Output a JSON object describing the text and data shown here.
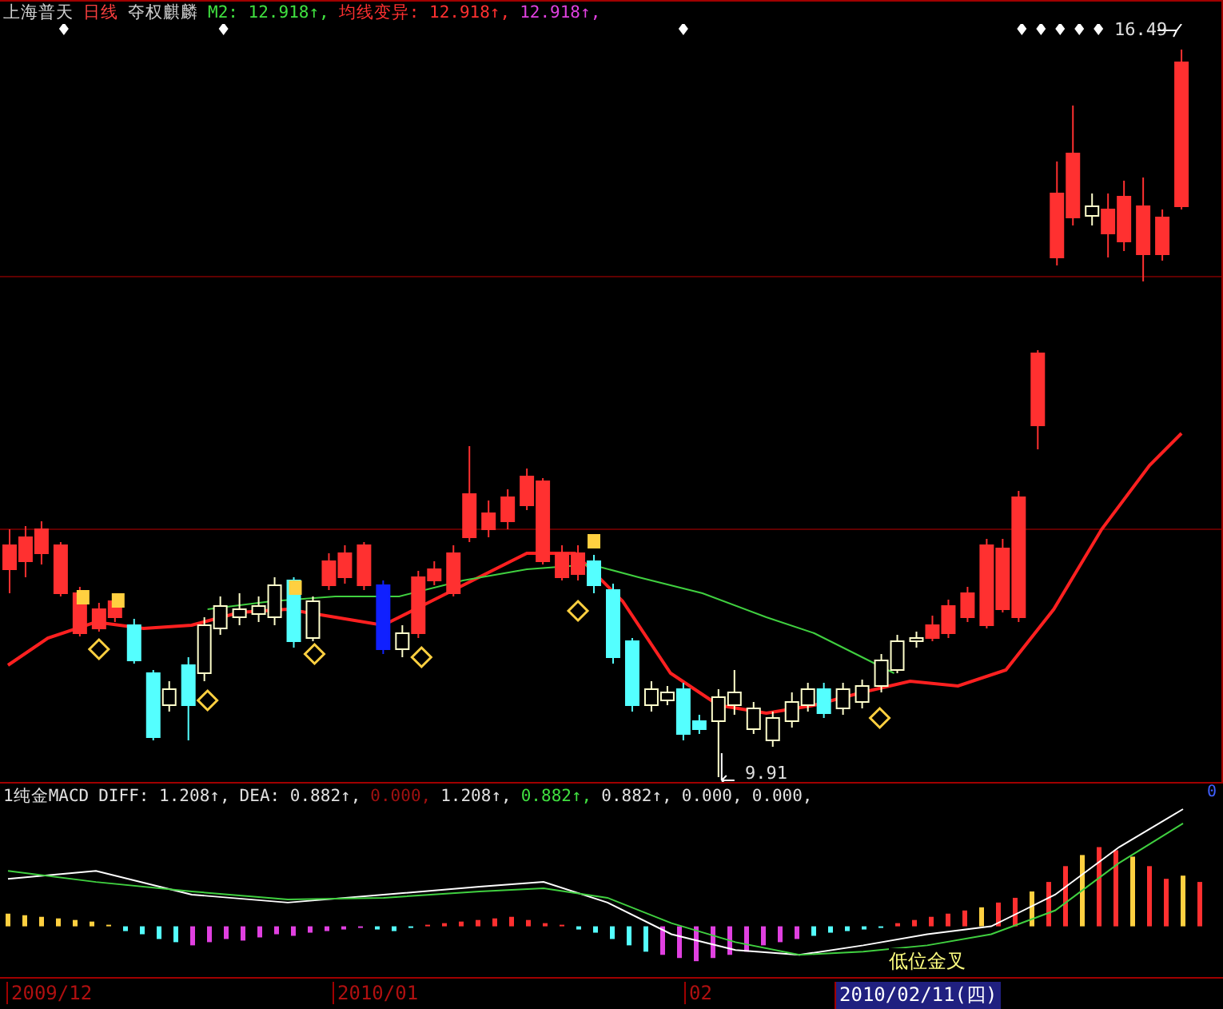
{
  "header": {
    "segments": [
      {
        "text": "上海普天",
        "color": "#d0d0d0"
      },
      {
        "text": "日线",
        "color": "#ff4040"
      },
      {
        "text": "夺权麒麟",
        "color": "#d0d0d0"
      },
      {
        "text": "M2: 12.918↑,",
        "color": "#40e040"
      },
      {
        "text": "均线变异: 12.918↑,",
        "color": "#ff3030"
      },
      {
        "text": "12.918↑,",
        "color": "#e040e0"
      }
    ]
  },
  "price_labels": {
    "high": "16.49",
    "low": "9.91"
  },
  "macd_header": {
    "segments": [
      {
        "text": "1纯金MACD",
        "color": "#e0e0e0"
      },
      {
        "text": "DIFF: 1.208↑,",
        "color": "#e0e0e0"
      },
      {
        "text": "DEA: 0.882↑,",
        "color": "#e0e0e0"
      },
      {
        "text": "0.000,",
        "color": "#a01010"
      },
      {
        "text": "1.208↑,",
        "color": "#e0e0e0"
      },
      {
        "text": "0.882↑,",
        "color": "#40e040"
      },
      {
        "text": "0.882↑,",
        "color": "#e0e0e0"
      },
      {
        "text": "0.000,",
        "color": "#e0e0e0"
      },
      {
        "text": "0.000,",
        "color": "#e0e0e0"
      }
    ],
    "corner": "0"
  },
  "macd_signal": "低位金叉",
  "time_axis": [
    {
      "label": "2009/12",
      "selected": false
    },
    {
      "label": "2010/01",
      "selected": false
    },
    {
      "label": "02",
      "selected": false
    },
    {
      "label": "2010/02/11(四)",
      "selected": true
    }
  ]
}
